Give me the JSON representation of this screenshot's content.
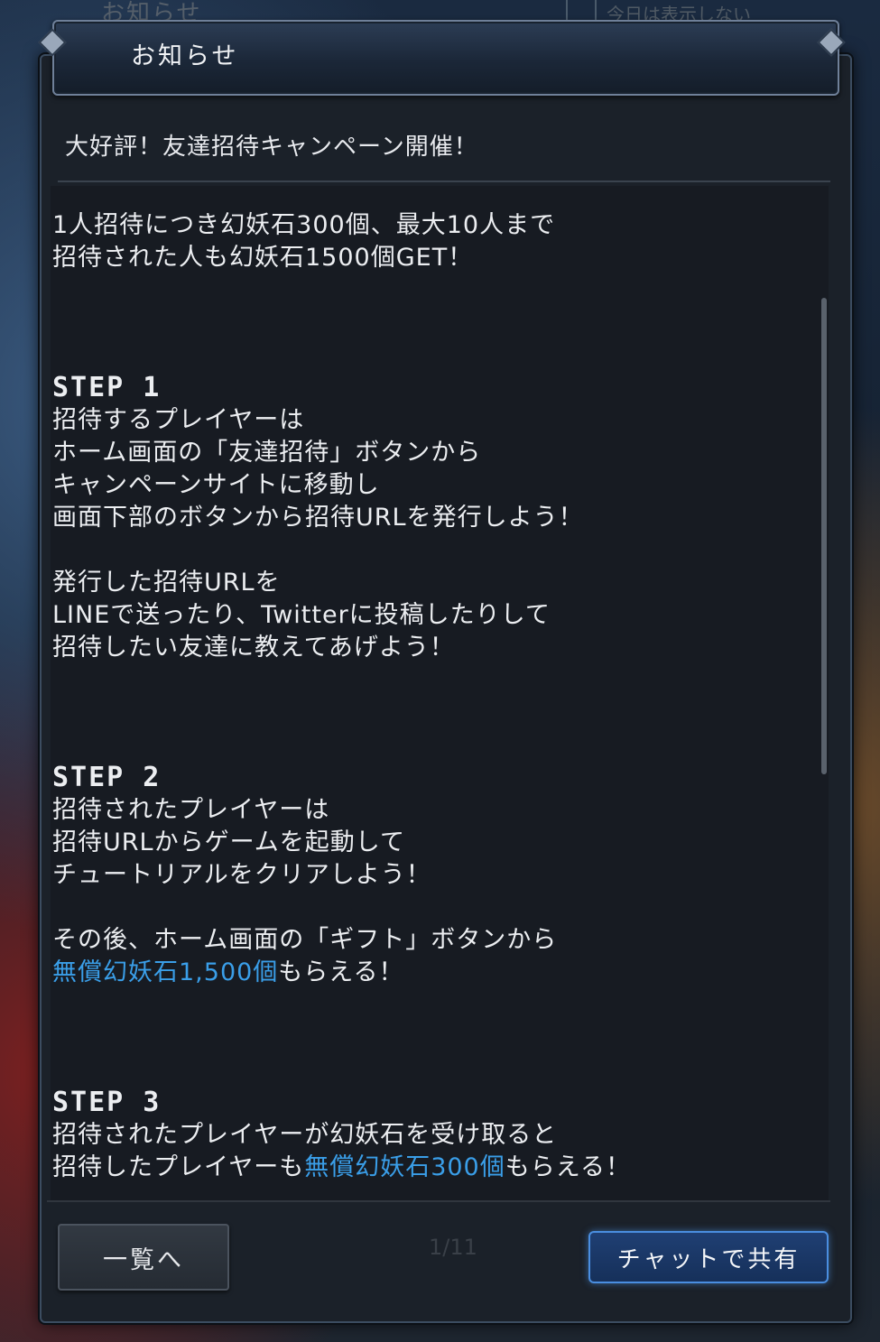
{
  "background": {
    "title": "お知らせ",
    "checkbox_label": "今日は表示しない",
    "pager": "1/11"
  },
  "dialog": {
    "title": "お知らせ",
    "subject": "大好評！友達招待キャンペーン開催！",
    "body": {
      "intro": [
        "1人招待につき幻妖石300個、最大10人まで",
        "招待された人も幻妖石1500個GET！"
      ],
      "step1": {
        "heading": "STEP 1",
        "lines": [
          "招待するプレイヤーは",
          "ホーム画面の「友達招待」ボタンから",
          "キャンペーンサイトに移動し",
          "画面下部のボタンから招待URLを発行しよう！"
        ],
        "lines2": [
          "発行した招待URLを",
          "LINEで送ったり、Twitterに投稿したりして",
          "招待したい友達に教えてあげよう！"
        ]
      },
      "step2": {
        "heading": "STEP 2",
        "lines": [
          "招待されたプレイヤーは",
          "招待URLからゲームを起動して",
          "チュートリアルをクリアしよう！"
        ],
        "after": "その後、ホーム画面の「ギフト」ボタンから",
        "reward_highlight": "無償幻妖石1,500個",
        "reward_rest": "もらえる！"
      },
      "step3": {
        "heading": "STEP 3",
        "lines": [
          "招待されたプレイヤーが幻妖石を受け取ると"
        ],
        "partial_plain": "招待したプレイヤーも",
        "partial_highlight": "無償幻妖石300個",
        "partial_rest": "もらえる！"
      }
    },
    "buttons": {
      "list_label": "一覧へ",
      "share_label": "チャットで共有"
    }
  },
  "colors": {
    "highlight": "#3a9ee8",
    "share_border": "#4a8ee0",
    "panel_bg": "#1b2129"
  }
}
